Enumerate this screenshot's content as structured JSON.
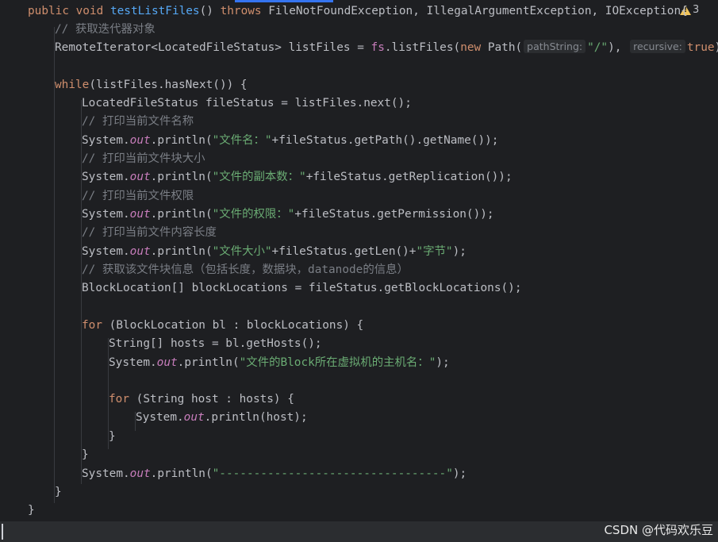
{
  "warnings": {
    "count": "3",
    "icon": "warning-triangle-icon",
    "color": "#f2c55c"
  },
  "code": {
    "l1": {
      "kw1": "public void ",
      "fn": "testListFiles",
      "paren": "() ",
      "kw2": "throws ",
      "exc1": "FileNotFoundException",
      "rest": ", IllegalArgumentException, IOException{"
    },
    "l2": {
      "comment": "// 获取迭代器对象"
    },
    "l3": {
      "a": "RemoteIterator<LocatedFileStatus> listFiles = ",
      "fs": "fs",
      "b": ".listFiles(",
      "kw": "new ",
      "c": "Path(",
      "hint1": "pathString:",
      "str1": "\"/\"",
      "d": "), ",
      "hint2": "recursive:",
      "kw2": "true",
      "e": ");"
    },
    "l4": {
      "kw": "while",
      "rest": "(listFiles.hasNext()) {"
    },
    "l5": {
      "text": "LocatedFileStatus fileStatus = listFiles.next();"
    },
    "l6": {
      "comment": "// 打印当前文件名称"
    },
    "l7": {
      "a": "System.",
      "out": "out",
      "b": ".println(",
      "str": "\"文件名：\"",
      "c": "+fileStatus.getPath().getName());"
    },
    "l8": {
      "comment": "// 打印当前文件块大小"
    },
    "l9": {
      "a": "System.",
      "out": "out",
      "b": ".println(",
      "str": "\"文件的副本数：\"",
      "c": "+fileStatus.getReplication());"
    },
    "l10": {
      "comment": "// 打印当前文件权限"
    },
    "l11": {
      "a": "System.",
      "out": "out",
      "b": ".println(",
      "str": "\"文件的权限：\"",
      "c": "+fileStatus.getPermission());"
    },
    "l12": {
      "comment": "// 打印当前文件内容长度"
    },
    "l13": {
      "a": "System.",
      "out": "out",
      "b": ".println(",
      "str": "\"文件大小\"",
      "c": "+fileStatus.getLen()+",
      "str2": "\"字节\"",
      "d": ");"
    },
    "l14": {
      "comment": "// 获取该文件块信息（包括长度，数据块，datanode的信息）"
    },
    "l15": {
      "text": "BlockLocation[] blockLocations = fileStatus.getBlockLocations();"
    },
    "l16": {
      "kw": "for ",
      "rest": "(BlockLocation bl : blockLocations) {"
    },
    "l17": {
      "text": "String[] hosts = bl.getHosts();"
    },
    "l18": {
      "a": "System.",
      "out": "out",
      "b": ".println(",
      "str": "\"文件的Block所在虚拟机的主机名：\"",
      "c": ");"
    },
    "l19": {
      "kw": "for ",
      "rest": "(String host : hosts) {"
    },
    "l20": {
      "a": "System.",
      "out": "out",
      "b": ".println(host);"
    },
    "l21": {
      "text": "}"
    },
    "l22": {
      "text": "}"
    },
    "l23": {
      "a": "System.",
      "out": "out",
      "b": ".println(",
      "str": "\"---------------------------------\"",
      "c": ");"
    },
    "l24": {
      "text": "}"
    },
    "l25": {
      "text": "}"
    }
  },
  "watermark": "CSDN @代码欢乐豆"
}
